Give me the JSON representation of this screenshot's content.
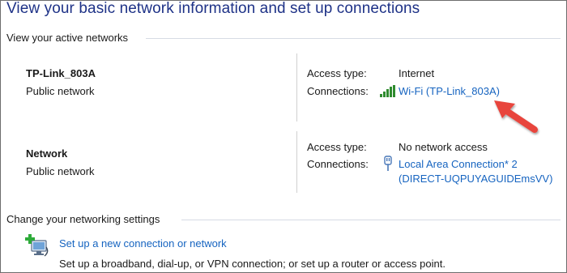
{
  "page_title": "View your basic network information and set up connections",
  "active_networks": {
    "header": "View your active networks",
    "networks": [
      {
        "name": "TP-Link_803A",
        "category": "Public network",
        "access_type_label": "Access type:",
        "access_type_value": "Internet",
        "connections_label": "Connections:",
        "connection_icon": "wifi-signal-icon",
        "connection_link": "Wi-Fi (TP-Link_803A)"
      },
      {
        "name": "Network",
        "category": "Public network",
        "access_type_label": "Access type:",
        "access_type_value": "No network access",
        "connections_label": "Connections:",
        "connection_icon": "ethernet-plug-icon",
        "connection_link_line1": "Local Area Connection* 2",
        "connection_link_line2": "(DIRECT-UQPUYAGUIDEmsVV)"
      }
    ]
  },
  "change_settings": {
    "header": "Change your networking settings",
    "items": [
      {
        "icon": "new-connection-icon",
        "link": "Set up a new connection or network",
        "description": "Set up a broadband, dial-up, or VPN connection; or set up a router or access point."
      }
    ]
  },
  "annotation": {
    "type": "red-arrow-icon",
    "color": "#e8453c"
  },
  "colors": {
    "title": "#1e3287",
    "link": "#1664c0",
    "rule": "#d6dbe4"
  }
}
